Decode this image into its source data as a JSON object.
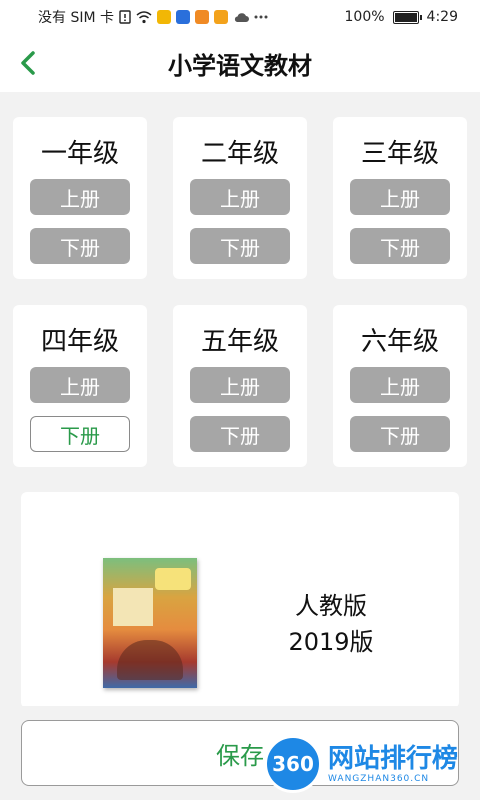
{
  "status_bar": {
    "carrier": "没有 SIM 卡",
    "battery": "100%",
    "battery_level": 1.0,
    "time": "4:29",
    "icons": [
      "sim-alert-icon",
      "wifi-icon",
      "mail-icon",
      "bulb-icon",
      "message-icon",
      "app-icon",
      "cloud-icon",
      "more-icon",
      "battery-icon"
    ]
  },
  "header": {
    "title": "小学语文教材",
    "back_icon": "chevron-left-icon"
  },
  "grades": [
    {
      "name": "一年级",
      "upper": "上册",
      "lower": "下册"
    },
    {
      "name": "二年级",
      "upper": "上册",
      "lower": "下册"
    },
    {
      "name": "三年级",
      "upper": "上册",
      "lower": "下册"
    },
    {
      "name": "四年级",
      "upper": "上册",
      "lower": "下册"
    },
    {
      "name": "五年级",
      "upper": "上册",
      "lower": "下册"
    },
    {
      "name": "六年级",
      "upper": "上册",
      "lower": "下册"
    }
  ],
  "selected": {
    "grade": "四年级",
    "volume": "下册"
  },
  "book": {
    "publisher": "人教版",
    "year": "2019版"
  },
  "save_button": "保存",
  "watermark": {
    "badge": "360",
    "title": "网站排行榜",
    "subtitle": "WANGZHAN360.CN"
  },
  "colors": {
    "accent": "#2a9a4a",
    "inactive_button": "#a6a6a6",
    "background": "#f2f2f2"
  }
}
